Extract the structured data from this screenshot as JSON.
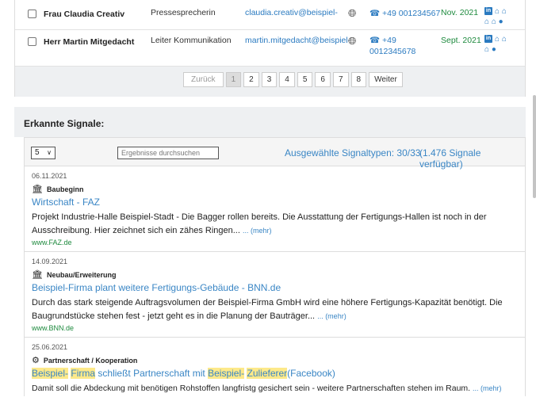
{
  "contacts": [
    {
      "name": "Frau Claudia Creativ",
      "role": "Pressesprecherin",
      "email": "claudia.creativ@beispiel-",
      "phone": "+49 001234567",
      "date": "Nov. 2021"
    },
    {
      "name": "Herr Martin Mitgedacht",
      "role": "Leiter Kommunikation",
      "email": "martin.mitgedacht@beispiel-",
      "phone_l1": "+49",
      "phone_l2": "0012345678",
      "date": "Sept. 2021"
    }
  ],
  "pagination": {
    "prev": "Zurück",
    "pages": [
      "1",
      "2",
      "3",
      "4",
      "5",
      "6",
      "7",
      "8"
    ],
    "current_page": "1",
    "next": "Weiter"
  },
  "signals": {
    "heading": "Erkannte Signale:",
    "page_size": "5",
    "search_placeholder": "Ergebnisse durchsuchen",
    "types_label": "Ausgewählte Signaltypen: 30/33",
    "available_label": "(1.476 Signale verfügbar)",
    "more_label": "... (mehr)",
    "items": [
      {
        "date": "06.11.2021",
        "type": "Baubeginn",
        "title": "Wirtschaft - FAZ",
        "text": "Projekt Industrie-Halle Beispiel-Stadt - Die Bagger rollen bereits. Die Ausstattung der Fertigungs-Hallen ist noch in der Ausschreibung. Hier zeichnet sich ein zähes Ringen...",
        "source": "www.FAZ.de"
      },
      {
        "date": "14.09.2021",
        "type": "Neubau/Erweiterung",
        "title": "Beispiel-Firma plant weitere Fertigungs-Gebäude - BNN.de",
        "text": "Durch das stark steigende Auftragsvolumen der Beispiel-Firma GmbH wird eine höhere Fertigungs-Kapazität benötigt. Die Baugrundstücke stehen fest - jetzt geht es in die Planung der Bauträger...",
        "source": "www.BNN.de"
      },
      {
        "date": "25.06.2021",
        "type": "Partnerschaft / Kooperation",
        "title_parts": [
          "Beispiel-",
          "Firma",
          "schließt Partnerschaft mit",
          "Beispiel-",
          "Zulieferer",
          "(Facebook)"
        ],
        "text": "Damit soll die Abdeckung mit benötigen Rohstoffen langfristg gesichert sein - weitere Partnerschaften stehen im Raum."
      }
    ]
  },
  "icons": {
    "globe": "globe-icon",
    "phone": "phone-icon",
    "linkedin": "linkedin-icon",
    "home": "home-icon",
    "bank": "bank-icon",
    "gears": "gears-icon"
  },
  "colors": {
    "link": "#3a86c5",
    "date_green": "#1e8a3e",
    "highlight": "#fde98a",
    "panel_bg": "#eef0f2"
  }
}
